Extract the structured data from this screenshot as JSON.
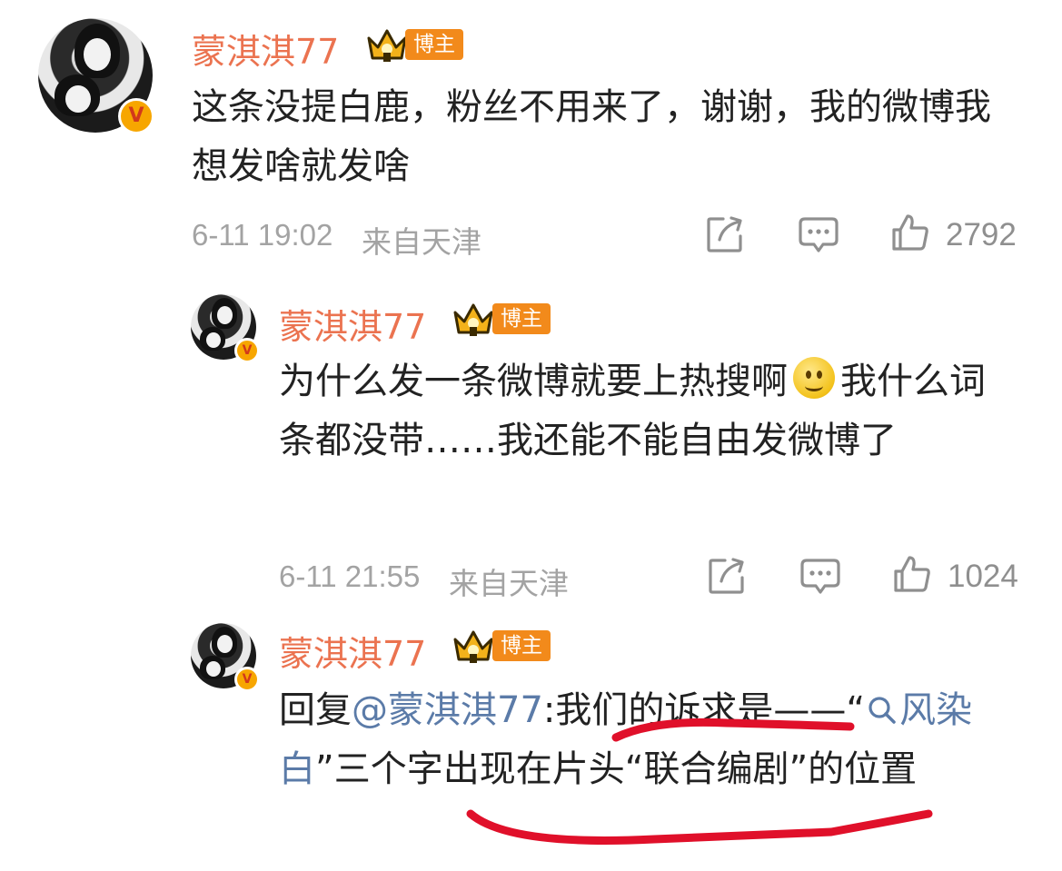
{
  "comments": [
    {
      "username": "蒙淇淇77",
      "badge": "博主",
      "verified_mark": "V",
      "text": "这条没提白鹿，粉丝不用来了，谢谢，我的微博我想发啥就发啥",
      "timestamp": "6-11 19:02",
      "location": "来自天津",
      "likes": "2792"
    },
    {
      "username": "蒙淇淇77",
      "badge": "博主",
      "verified_mark": "V",
      "text_part1": "为什么发一条微博就要上热搜啊",
      "text_part2": "我什么词条都没带……我还能不能自由发微博了",
      "emoji": "smile-emoji",
      "timestamp": "6-11 21:55",
      "location": "来自天津",
      "likes": "1024"
    },
    {
      "username": "蒙淇淇77",
      "badge": "博主",
      "verified_mark": "V",
      "reply_prefix": "回复",
      "mention": "@蒙淇淇77",
      "text_part1": ":我们的诉求是——“",
      "topic": "风染白",
      "text_part2": "”三个字出现在片头“联合编剧”的位置"
    }
  ],
  "icons": {
    "share": "share-icon",
    "comment": "comment-icon",
    "like": "thumbs-up-icon",
    "search": "search-icon",
    "crown": "crown-icon"
  },
  "colors": {
    "username": "#eb7350",
    "link": "#5b7ba8",
    "meta": "#a3a3a3",
    "badge": "#f28a1b",
    "annotation": "#e0102a"
  }
}
